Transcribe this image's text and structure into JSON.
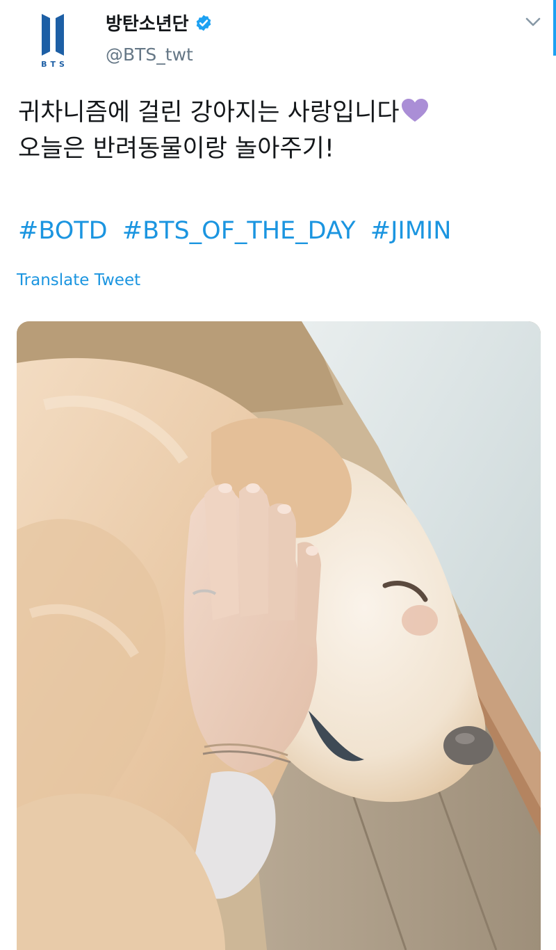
{
  "account": {
    "display_name": "방탄소년단",
    "handle": "@BTS_twt",
    "avatar_caption": "BTS",
    "verified": true,
    "avatar_icon": "bts-logo-icon",
    "verified_icon": "verified-badge-icon",
    "menu_icon": "chevron-down-icon"
  },
  "tweet": {
    "lines": [
      "귀차니즘에 걸린 강아지는 사랑입니다",
      "오늘은 반려동물이랑 놀아주기!"
    ],
    "emoji": "purple-heart-icon",
    "hashtags": [
      "#BOTD",
      "#BTS_OF_THE_DAY",
      "#JIMIN"
    ],
    "translate_label": "Translate Tweet"
  },
  "media": {
    "type": "photo",
    "icon": "photo-dog-hand"
  },
  "colors": {
    "link": "#1b95e0",
    "text": "#14171a",
    "secondary": "#657786",
    "verified": "#1da1f2",
    "heart": "#aa8ed6",
    "brand": "#1d5fa5"
  }
}
